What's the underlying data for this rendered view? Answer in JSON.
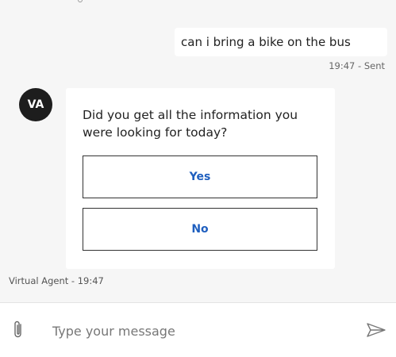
{
  "user_message": {
    "text": "can i bring a bike on the bus",
    "meta": "19:47 - Sent"
  },
  "agent": {
    "avatar_initials": "VA",
    "question": "Did you get all the information you were looking for today?",
    "choices": [
      {
        "label": "Yes"
      },
      {
        "label": "No"
      }
    ],
    "meta": "Virtual Agent - 19:47"
  },
  "composer": {
    "placeholder": "Type your message",
    "attach_icon": "paperclip-icon",
    "send_icon": "send-icon"
  },
  "colors": {
    "background": "#f6f6f6",
    "avatar": "#1d1d1d",
    "choice_text": "#1f5fbf"
  }
}
